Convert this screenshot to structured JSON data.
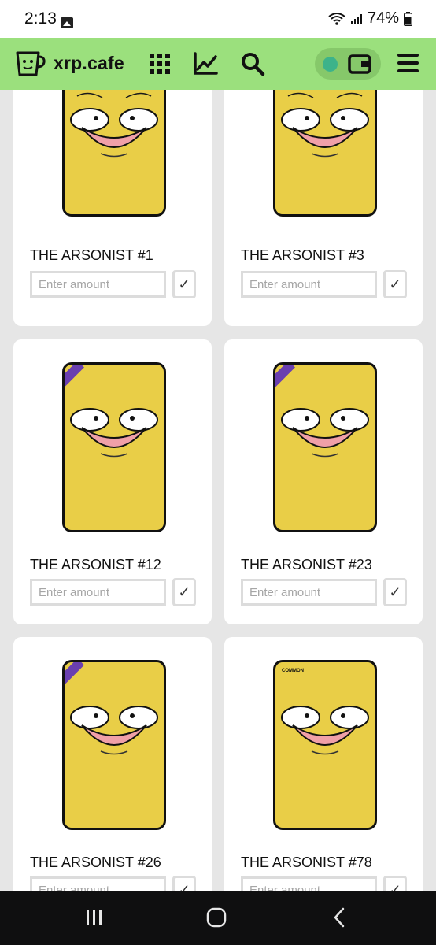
{
  "status_bar": {
    "time": "2:13",
    "battery": "74%",
    "icons": [
      "gallery-icon",
      "wifi-icon",
      "signal-icon",
      "battery-icon"
    ]
  },
  "header": {
    "brand": "xrp.cafe",
    "icons": [
      "cup-logo-icon",
      "grid-icon",
      "chart-icon",
      "search-icon",
      "wallet-icon",
      "menu-icon"
    ],
    "accent_color": "#9be07d",
    "toggle_dot_color": "#3db38a"
  },
  "items": [
    {
      "name": "THE ARSONIST #1",
      "placeholder": "Enter amount",
      "confirm": "✓",
      "tag": ""
    },
    {
      "name": "THE ARSONIST #3",
      "placeholder": "Enter amount",
      "confirm": "✓",
      "tag": ""
    },
    {
      "name": "THE ARSONIST #12",
      "placeholder": "Enter amount",
      "confirm": "✓",
      "tag": ""
    },
    {
      "name": "THE ARSONIST #23",
      "placeholder": "Enter amount",
      "confirm": "✓",
      "tag": ""
    },
    {
      "name": "THE ARSONIST #26",
      "placeholder": "Enter amount",
      "confirm": "✓",
      "tag": ""
    },
    {
      "name": "THE ARSONIST #78",
      "placeholder": "Enter amount",
      "confirm": "✓",
      "tag": "COMMON"
    }
  ],
  "nav_bar": {
    "icons": [
      "recent-apps-icon",
      "home-icon",
      "back-icon"
    ]
  }
}
